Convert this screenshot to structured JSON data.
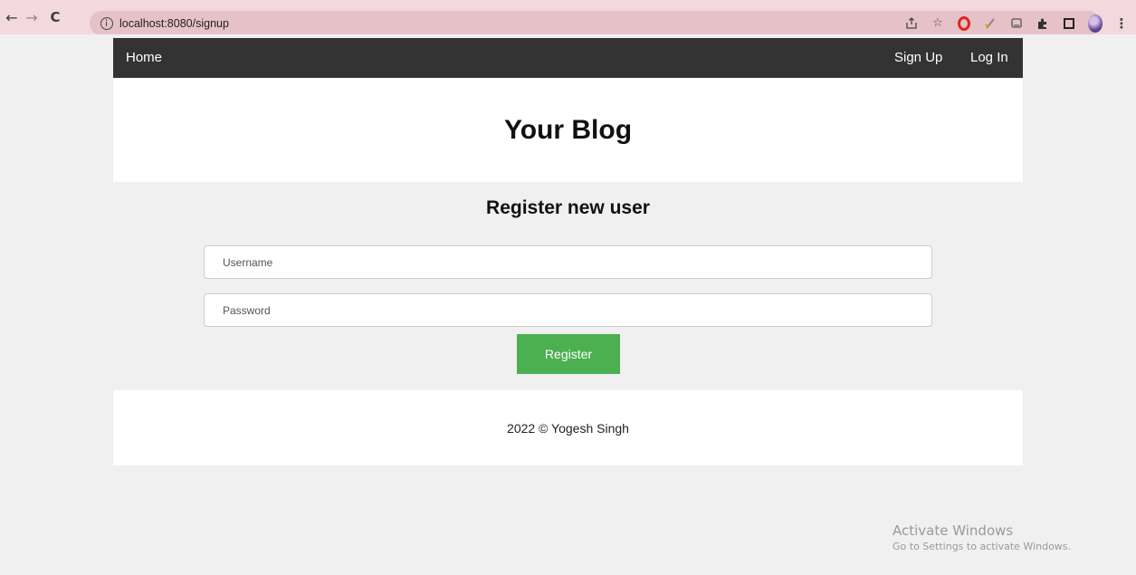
{
  "browser": {
    "url": "localhost:8080/signup",
    "icons": [
      "back-arrow-icon",
      "forward-arrow-icon",
      "reload-icon",
      "info-icon",
      "share-icon",
      "star-icon",
      "opera-icon",
      "extension-icon",
      "media-icon",
      "puzzle-icon",
      "sidebar-icon",
      "profile-avatar",
      "menu-icon"
    ]
  },
  "nav": {
    "home": "Home",
    "signup": "Sign Up",
    "login": "Log In"
  },
  "header": {
    "title": "Your Blog"
  },
  "form": {
    "title": "Register new user",
    "username_placeholder": "Username",
    "password_placeholder": "Password",
    "register_label": "Register"
  },
  "footer": {
    "text": "2022 © Yogesh Singh"
  },
  "watermark": {
    "title": "Activate Windows",
    "subtitle": "Go to Settings to activate Windows."
  },
  "colors": {
    "browser_bar": "#f3d9dd",
    "nav_bg": "#333333",
    "register_button": "#4caf50",
    "page_bg": "#f0f0f0"
  }
}
